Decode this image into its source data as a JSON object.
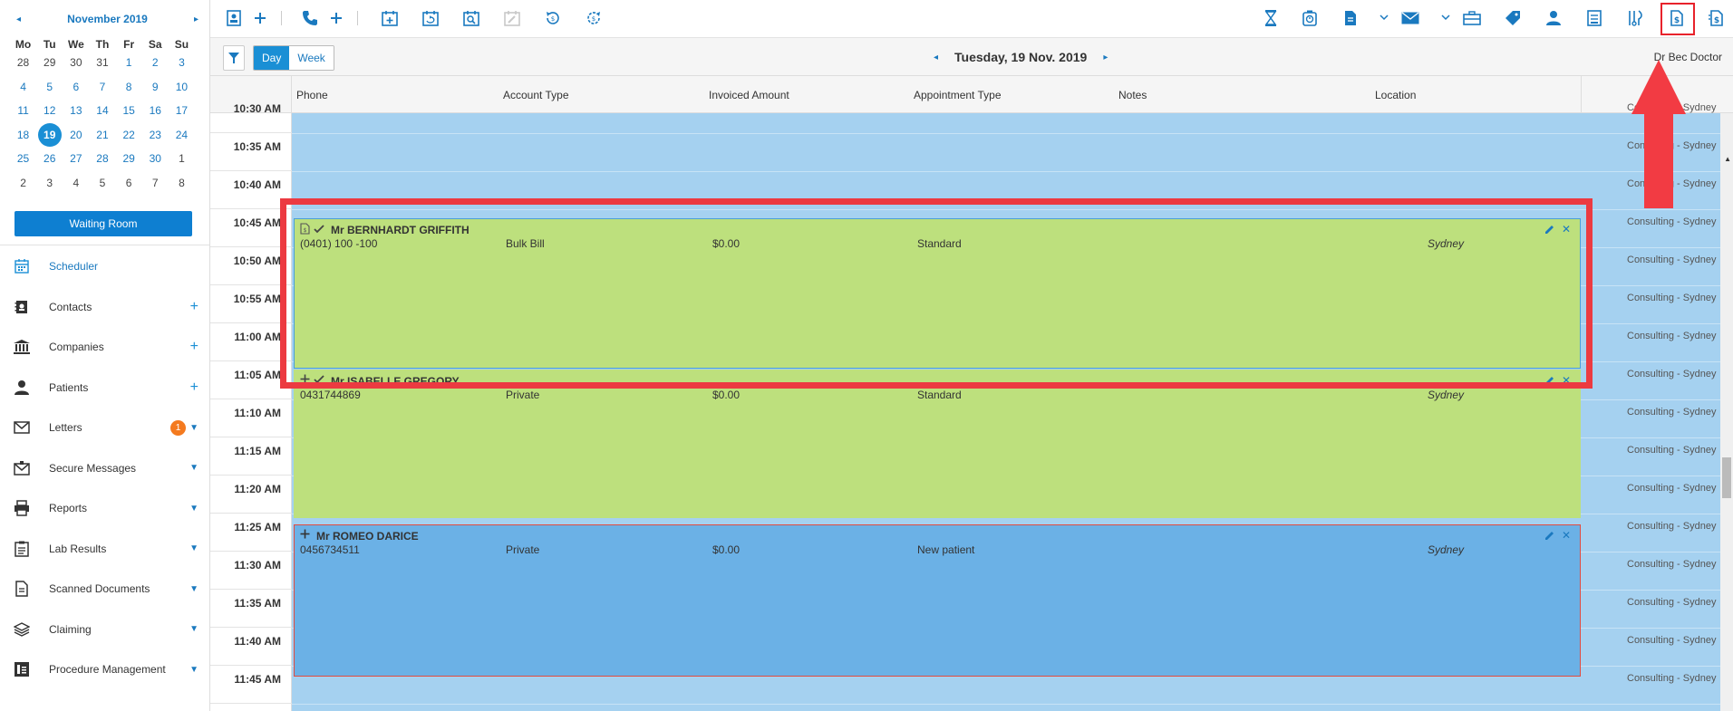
{
  "calendar": {
    "prev": "◂",
    "next": "▸",
    "month_label": "November 2019",
    "weekdays": [
      "Mo",
      "Tu",
      "We",
      "Th",
      "Fr",
      "Sa",
      "Su"
    ],
    "weeks": [
      [
        "28",
        "29",
        "30",
        "31",
        "1",
        "2",
        "3"
      ],
      [
        "4",
        "5",
        "6",
        "7",
        "8",
        "9",
        "10"
      ],
      [
        "11",
        "12",
        "13",
        "14",
        "15",
        "16",
        "17"
      ],
      [
        "18",
        "19",
        "20",
        "21",
        "22",
        "23",
        "24"
      ],
      [
        "25",
        "26",
        "27",
        "28",
        "29",
        "30",
        "1"
      ],
      [
        "2",
        "3",
        "4",
        "5",
        "6",
        "7",
        "8"
      ]
    ],
    "selected": "19"
  },
  "waiting_room_label": "Waiting Room",
  "menu": [
    {
      "label": "Scheduler",
      "icon": "calendar-icon",
      "active": true
    },
    {
      "label": "Contacts",
      "icon": "contacts-book-icon",
      "plus": true
    },
    {
      "label": "Companies",
      "icon": "bank-icon",
      "plus": true
    },
    {
      "label": "Patients",
      "icon": "person-icon",
      "plus": true
    },
    {
      "label": "Letters",
      "icon": "envelope-icon",
      "badge": "1",
      "caret": true
    },
    {
      "label": "Secure Messages",
      "icon": "secure-mail-icon",
      "caret": true
    },
    {
      "label": "Reports",
      "icon": "printer-icon",
      "caret": true
    },
    {
      "label": "Lab Results",
      "icon": "clipboard-icon",
      "caret": true
    },
    {
      "label": "Scanned Documents",
      "icon": "document-icon",
      "caret": true
    },
    {
      "label": "Claiming",
      "icon": "layers-icon",
      "caret": true
    },
    {
      "label": "Procedure Management",
      "icon": "procedure-icon",
      "caret": true
    }
  ],
  "toolbar": {
    "left_icons": [
      "patient-card-icon",
      "add-icon",
      "phone-icon",
      "add-icon",
      "calendar-add-icon",
      "calendar-repeat-icon",
      "calendar-search-icon",
      "calendar-edit-icon",
      "history-icon",
      "refund-icon"
    ],
    "right_icons": [
      "hourglass-icon",
      "stopwatch-icon",
      "document-icon",
      "mail-icon",
      "briefcase-icon",
      "tag-icon",
      "person-icon",
      "notes-icon",
      "instruments-icon",
      "invoice-icon",
      "invoice-list-icon"
    ],
    "highlighted_icon": "invoice-icon"
  },
  "datebar": {
    "view_day": "Day",
    "view_week": "Week",
    "active_view": "Day",
    "date": "Tuesday, 19 Nov. 2019",
    "prev": "◂",
    "next": "▸",
    "doctor": "Dr Bec Doctor"
  },
  "columns": [
    "Phone",
    "Account Type",
    "Invoiced Amount",
    "Appointment Type",
    "Notes",
    "Location"
  ],
  "time_slots": [
    "10:30 AM",
    "10:35 AM",
    "10:40 AM",
    "10:45 AM",
    "10:50 AM",
    "10:55 AM",
    "11:00 AM",
    "11:05 AM",
    "11:10 AM",
    "11:15 AM",
    "11:20 AM",
    "11:25 AM",
    "11:30 AM",
    "11:35 AM",
    "11:40 AM",
    "11:45 AM"
  ],
  "slot_location": "Consulting - Sydney",
  "appointments": [
    {
      "name": "Mr BERNHARDT GRIFFITH",
      "phone": "(0401) 100 -100",
      "account_type": "Bulk Bill",
      "invoiced": "$0.00",
      "appointment_type": "Standard",
      "location": "Sydney",
      "status_icons": [
        "invoice-small-icon",
        "checkmark-icon"
      ],
      "color": "#bde07d",
      "border": "#4a9fd8"
    },
    {
      "name": "Mr ISABELLE GREGORY",
      "phone": "0431744869",
      "account_type": "Private",
      "invoiced": "$0.00",
      "appointment_type": "Standard",
      "location": "Sydney",
      "status_icons": [
        "plus-icon",
        "checkmark-icon"
      ],
      "color": "#bde07d",
      "border": "#bde07d"
    },
    {
      "name": "Mr ROMEO DARICE",
      "phone": "0456734511",
      "account_type": "Private",
      "invoiced": "$0.00",
      "appointment_type": "New patient",
      "location": "Sydney",
      "status_icons": [
        "plus-icon"
      ],
      "color": "#6bb1e6",
      "border": "#e24b3f"
    }
  ],
  "colors": {
    "accent": "#1a8fd5",
    "link": "#1a79bf",
    "slot_bg": "#a5d1f0",
    "badge": "#f47a1f",
    "annotation_red": "#ec3a41"
  }
}
